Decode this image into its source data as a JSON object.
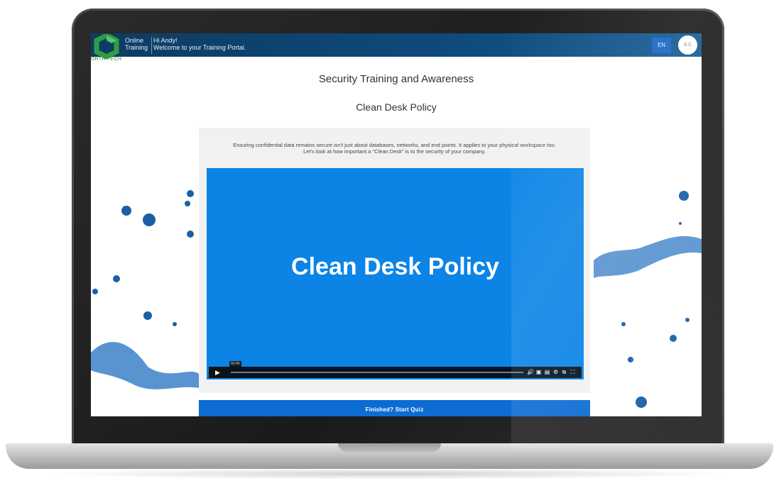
{
  "header": {
    "app_name_line1": "Online",
    "app_name_line2": "Training",
    "greeting_line1": "Hi Andy!",
    "greeting_line2": "Welcome to your Training Portal.",
    "logo_text": "ORTH TECH",
    "language": "EN",
    "avatar_initials": "A C"
  },
  "page": {
    "title": "Security Training and Awareness",
    "subtitle": "Clean Desk Policy"
  },
  "card": {
    "intro_line1": "Ensuring confidential data remains secure isn't just about databases, networks, and end points. It applies to your physical workspace too.",
    "intro_line2": "Let's look at how important a \"Clean Desk\" is to the security of your company."
  },
  "video": {
    "title": "Clean Desk Policy",
    "time": "02:40",
    "progress": 0.0,
    "icons": [
      "play-icon",
      "volume-icon",
      "captions-icon",
      "transcript-icon",
      "settings-icon",
      "pip-icon",
      "fullscreen-icon"
    ]
  },
  "quiz": {
    "label": "Finished? Start Quiz"
  },
  "colors": {
    "header": "#0f4a7b",
    "accent": "#0d6cd4",
    "video_bg": "#0b84e6",
    "logo_green": "#2e8b3a"
  }
}
